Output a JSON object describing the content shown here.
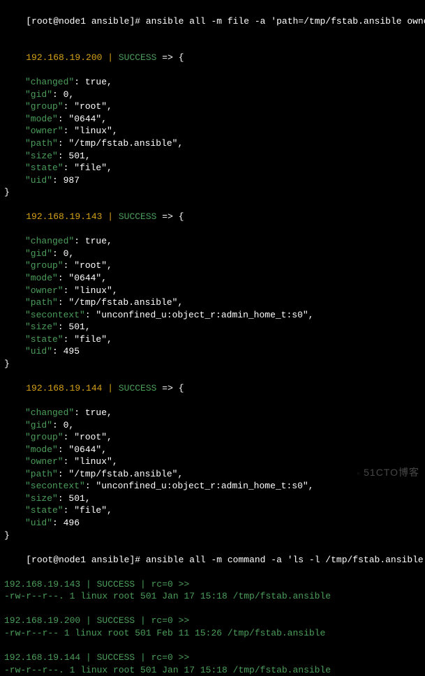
{
  "prompt1": {
    "prefix": "[root@node1 ansible]# ",
    "command": "ansible all -m file -a 'path=/tmp/fstab.ansible owner=linux'"
  },
  "results": [
    {
      "host": "192.168.19.200",
      "status": "SUCCESS",
      "arrow": "=>",
      "open": "{",
      "fields": [
        {
          "k": "\"changed\"",
          "v": ": true,"
        },
        {
          "k": "\"gid\"",
          "v": ": 0,"
        },
        {
          "k": "\"group\"",
          "v": ": \"root\","
        },
        {
          "k": "\"mode\"",
          "v": ": \"0644\","
        },
        {
          "k": "\"owner\"",
          "v": ": \"linux\","
        },
        {
          "k": "\"path\"",
          "v": ": \"/tmp/fstab.ansible\","
        },
        {
          "k": "\"size\"",
          "v": ": 501,"
        },
        {
          "k": "\"state\"",
          "v": ": \"file\","
        },
        {
          "k": "\"uid\"",
          "v": ": 987"
        }
      ],
      "close": "}"
    },
    {
      "host": "192.168.19.143",
      "status": "SUCCESS",
      "arrow": "=>",
      "open": "{",
      "fields": [
        {
          "k": "\"changed\"",
          "v": ": true,"
        },
        {
          "k": "\"gid\"",
          "v": ": 0,"
        },
        {
          "k": "\"group\"",
          "v": ": \"root\","
        },
        {
          "k": "\"mode\"",
          "v": ": \"0644\","
        },
        {
          "k": "\"owner\"",
          "v": ": \"linux\","
        },
        {
          "k": "\"path\"",
          "v": ": \"/tmp/fstab.ansible\","
        },
        {
          "k": "\"secontext\"",
          "v": ": \"unconfined_u:object_r:admin_home_t:s0\","
        },
        {
          "k": "\"size\"",
          "v": ": 501,"
        },
        {
          "k": "\"state\"",
          "v": ": \"file\","
        },
        {
          "k": "\"uid\"",
          "v": ": 495"
        }
      ],
      "close": "}"
    },
    {
      "host": "192.168.19.144",
      "status": "SUCCESS",
      "arrow": "=>",
      "open": "{",
      "fields": [
        {
          "k": "\"changed\"",
          "v": ": true,"
        },
        {
          "k": "\"gid\"",
          "v": ": 0,"
        },
        {
          "k": "\"group\"",
          "v": ": \"root\","
        },
        {
          "k": "\"mode\"",
          "v": ": \"0644\","
        },
        {
          "k": "\"owner\"",
          "v": ": \"linux\","
        },
        {
          "k": "\"path\"",
          "v": ": \"/tmp/fstab.ansible\","
        },
        {
          "k": "\"secontext\"",
          "v": ": \"unconfined_u:object_r:admin_home_t:s0\","
        },
        {
          "k": "\"size\"",
          "v": ": 501,"
        },
        {
          "k": "\"state\"",
          "v": ": \"file\","
        },
        {
          "k": "\"uid\"",
          "v": ": 496"
        }
      ],
      "close": "}"
    }
  ],
  "prompt2": {
    "prefix": "[root@node1 ansible]# ",
    "command": "ansible all -m command -a 'ls -l /tmp/fstab.ansible'"
  },
  "ls_results": [
    {
      "host": "192.168.19.143",
      "status_line": " | SUCCESS | rc=0 >>",
      "output": "-rw-r--r--. 1 linux root 501 Jan 17 15:18 /tmp/fstab.ansible"
    },
    {
      "host": "192.168.19.200",
      "status_line": " | SUCCESS | rc=0 >>",
      "output": "-rw-r--r-- 1 linux root 501 Feb 11 15:26 /tmp/fstab.ansible"
    },
    {
      "host": "192.168.19.144",
      "status_line": " | SUCCESS | rc=0 >>",
      "output": "-rw-r--r--. 1 linux root 501 Jan 17 15:18 /tmp/fstab.ansible"
    }
  ],
  "watermark": "51CTO博客",
  "pipe": " | "
}
